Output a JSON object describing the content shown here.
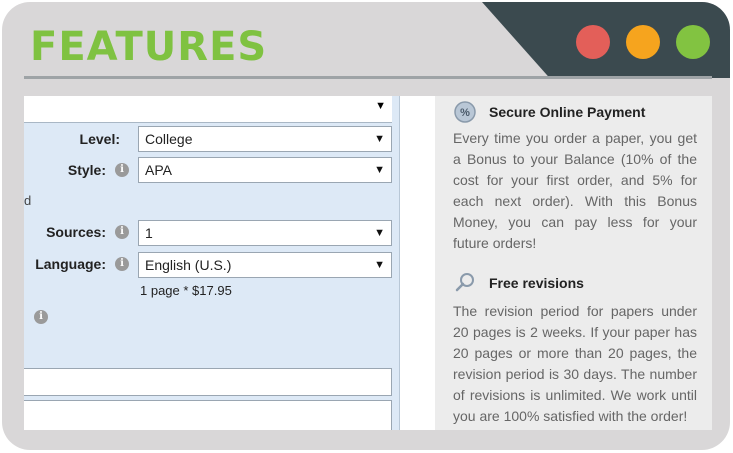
{
  "header": {
    "title": "FEATURES"
  },
  "window_controls": {
    "colors": {
      "close": "#e35f59",
      "minimize": "#f6a41e",
      "maximize": "#82c341"
    }
  },
  "form": {
    "level": {
      "label": "Level:",
      "value": "College"
    },
    "style": {
      "label": "Style:",
      "value": "APA"
    },
    "sources": {
      "label": "Sources:",
      "value": "1"
    },
    "language": {
      "label": "Language:",
      "value": "English (U.S.)"
    },
    "price_summary": "1 page * $17.95",
    "info_glyph": "i",
    "stray_char": "d"
  },
  "features": [
    {
      "icon": "percent-badge-icon",
      "title": "Secure Online Payment",
      "text": "Every time you order a paper, you get a Bonus to your Balance (10% of the cost for your first order, and 5% for each next order). With this Bonus Money, you can pay less for your future orders!"
    },
    {
      "icon": "magnifier-icon",
      "title": "Free revisions",
      "text": "The revision period for papers under 20 pages is 2 weeks. If your paper has 20 pages or more than 20 pages, the revision period is 30 days. The number of revisions is unlimited. We work until you are 100% satisfied with the order!"
    }
  ]
}
